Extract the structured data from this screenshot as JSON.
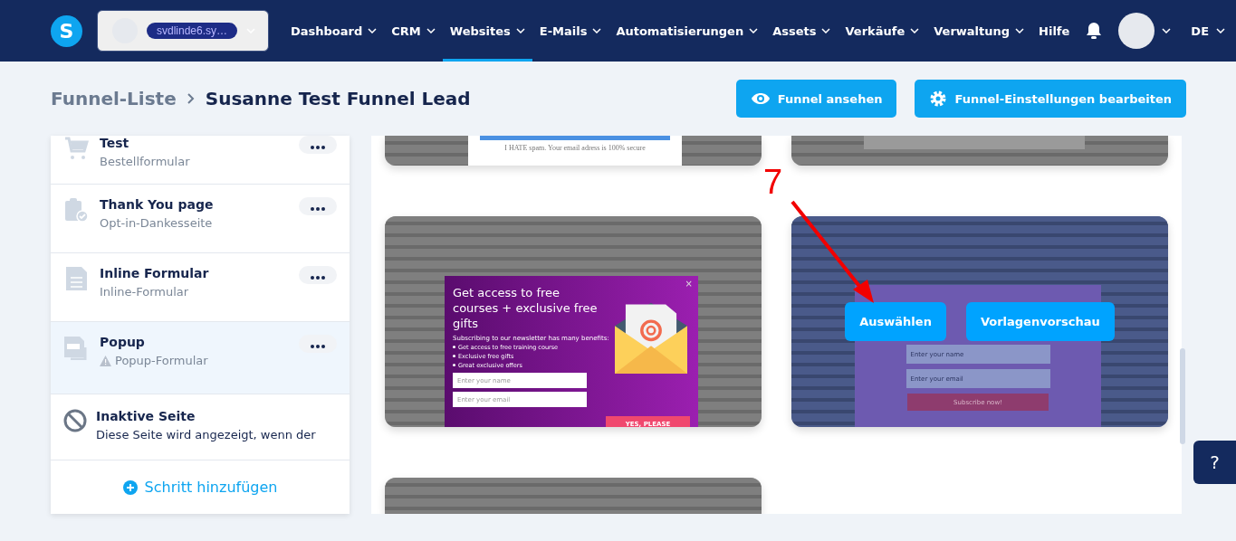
{
  "header": {
    "logo": "S",
    "account": {
      "name": "svdlinde6.sy…"
    },
    "nav": [
      {
        "label": "Dashboard",
        "dropdown": true,
        "selected": false
      },
      {
        "label": "CRM",
        "dropdown": true,
        "selected": false
      },
      {
        "label": "Websites",
        "dropdown": true,
        "selected": true
      },
      {
        "label": "E-Mails",
        "dropdown": true,
        "selected": false
      },
      {
        "label": "Automatisierungen",
        "dropdown": true,
        "selected": false
      },
      {
        "label": "Assets",
        "dropdown": true,
        "selected": false
      },
      {
        "label": "Verkäufe",
        "dropdown": true,
        "selected": false
      },
      {
        "label": "Verwaltung",
        "dropdown": true,
        "selected": false
      },
      {
        "label": "Hilfe",
        "dropdown": false,
        "selected": false
      }
    ],
    "language": "DE"
  },
  "breadcrumb": {
    "parent": "Funnel-Liste",
    "current": "Susanne Test Funnel Lead"
  },
  "actions": [
    {
      "label": "Funnel ansehen"
    },
    {
      "label": "Funnel-Einstellungen bearbeiten"
    }
  ],
  "steps": [
    {
      "title": "Test",
      "subtitle": "Bestellformular",
      "selected": false,
      "warning": false
    },
    {
      "title": "Thank You page",
      "subtitle": "Opt-in-Dankesseite",
      "selected": false,
      "warning": false
    },
    {
      "title": "Inline Formular",
      "subtitle": "Inline-Formular",
      "selected": false,
      "warning": false
    },
    {
      "title": "Popup",
      "subtitle": "Popup-Formular",
      "selected": true,
      "warning": true
    }
  ],
  "inactive_page": {
    "title": "Inaktive Seite",
    "description": "Diese Seite wird angezeigt, wenn der"
  },
  "add_step": "Schritt hinzufügen",
  "templates": [
    {
      "kind": "spam-form",
      "note": "I HATE spam. Your email adress is 100% secure",
      "hovered": false
    },
    {
      "kind": "photo",
      "hovered": false
    },
    {
      "kind": "offer-popup",
      "headline": "Get access to free courses + exclusive free gifts",
      "intro": "Subscribing to our newsletter has many benefits:",
      "bullets": [
        "Get access to free training course",
        "Exclusive free gifts",
        "Great exclusive offers"
      ],
      "name_placeholder": "Enter your name",
      "email_placeholder": "Enter your email",
      "button": "YES, PLEASE",
      "close": "×",
      "hovered": false
    },
    {
      "kind": "newsletter-popup",
      "name_placeholder": "Enter your name",
      "email_placeholder": "Enter your email",
      "button": "Subscribe now!",
      "hovered": true,
      "hover_actions": [
        "Auswählen",
        "Vorlagenvorschau"
      ]
    },
    {
      "kind": "plain",
      "hovered": false
    }
  ],
  "annotation": {
    "label": "7"
  },
  "help": "?"
}
